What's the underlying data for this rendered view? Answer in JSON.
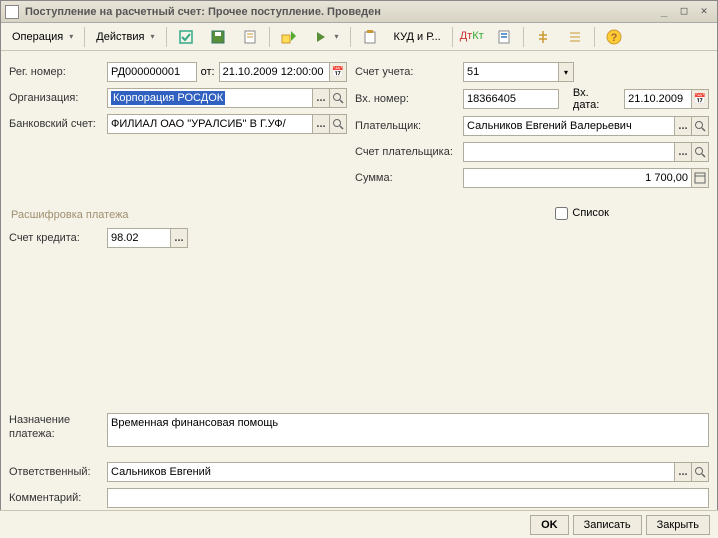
{
  "title": "Поступление на расчетный счет: Прочее поступление. Проведен",
  "menu": {
    "operation": "Операция",
    "actions": "Действия"
  },
  "toolbar": {
    "kudir": "КУД и Р..."
  },
  "labels": {
    "reg_no": "Рег. номер:",
    "from": "от:",
    "org": "Организация:",
    "bank_acc": "Банковский счет:",
    "account": "Счет учета:",
    "vh_no": "Вх. номер:",
    "vh_date": "Вх. дата:",
    "payer": "Плательщик:",
    "payer_acc": "Счет плательщика:",
    "sum": "Сумма:",
    "decode": "Расшифровка платежа",
    "list": "Список",
    "credit_acc": "Счет кредита:",
    "purpose1": "Назначение",
    "purpose2": "платежа:",
    "responsible": "Ответственный:",
    "comment": "Комментарий:"
  },
  "values": {
    "reg_no": "РД000000001",
    "date": "21.10.2009 12:00:00",
    "org": "Корпорация РОСДОК",
    "bank_acc": "ФИЛИАЛ ОАО \"УРАЛСИБ\" В Г.УФ/",
    "account": "51",
    "vh_no": "18366405",
    "vh_date": "21.10.2009",
    "payer": "Сальников Евгений Валерьевич",
    "payer_acc": "",
    "sum": "1 700,00",
    "credit_acc": "98.02",
    "purpose": "Временная финансовая помощь",
    "responsible": "Сальников Евгений",
    "comment": ""
  },
  "footer": {
    "ok": "OK",
    "save": "Записать",
    "close": "Закрыть"
  }
}
